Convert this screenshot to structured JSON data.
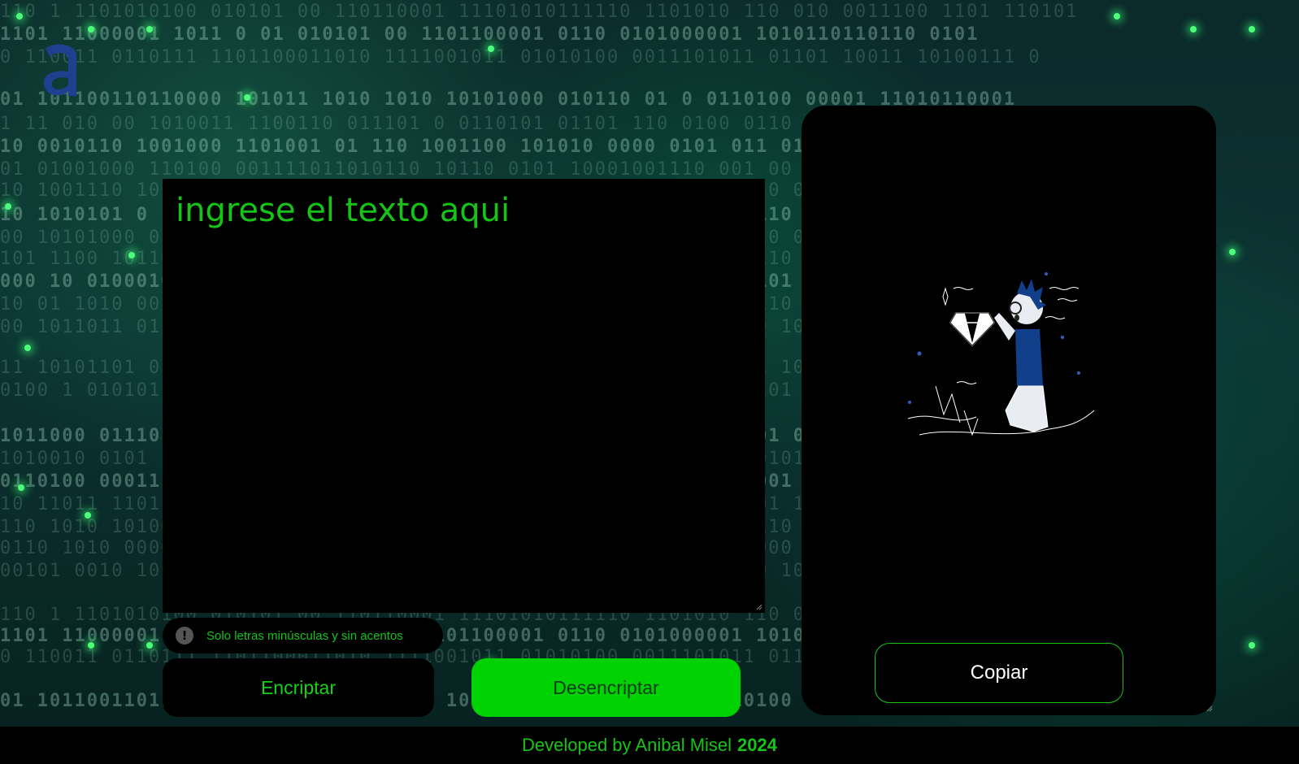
{
  "logo": {
    "letter": "a",
    "color": "#1f3f8f"
  },
  "editor": {
    "placeholder": "ingrese el texto aqui",
    "value": ""
  },
  "hint": {
    "icon": "exclamation-icon",
    "text": "Solo letras minúsculas y sin acentos"
  },
  "buttons": {
    "encrypt": "Encriptar",
    "decrypt": "Desencriptar"
  },
  "output": {
    "illustration": "person-with-magnifier-and-diamond",
    "copy_label": "Copiar"
  },
  "footer": {
    "text": "Developed by Anibal Misel",
    "year": "2024"
  },
  "colors": {
    "accent_green": "#16c416",
    "button_green": "#00d100",
    "panel_black": "#000000",
    "logo_blue": "#1f3f8f"
  }
}
